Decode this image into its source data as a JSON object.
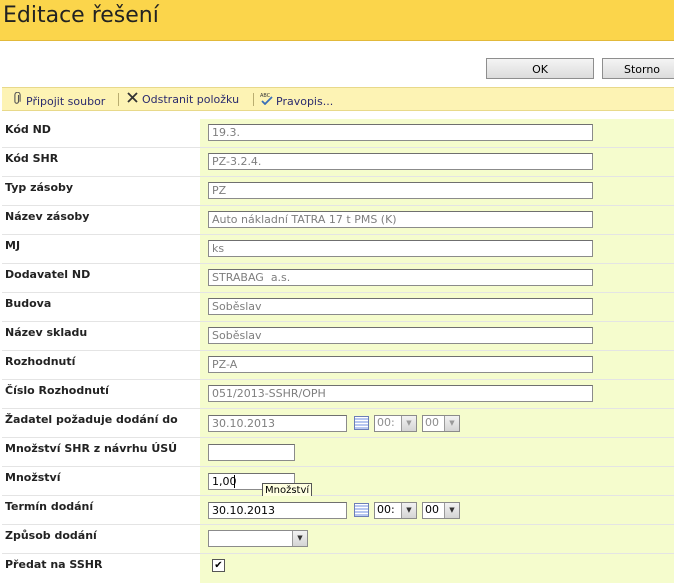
{
  "page": {
    "title": "Editace řešení"
  },
  "buttons": {
    "ok": "OK",
    "cancel": "Storno"
  },
  "toolbar": {
    "attach": "Připojit soubor",
    "remove": "Odstranit položku",
    "spell": "Pravopis..."
  },
  "fields": [
    {
      "label": "Kód ND",
      "value": "19.3."
    },
    {
      "label": "Kód SHR",
      "value": "PZ-3.2.4."
    },
    {
      "label": "Typ zásoby",
      "value": "PZ"
    },
    {
      "label": "Název zásoby",
      "value": "Auto nákladní TATRA 17 t PMS (K)"
    },
    {
      "label": "MJ",
      "value": "ks"
    },
    {
      "label": "Dodavatel ND",
      "value": "STRABAG  a.s."
    },
    {
      "label": "Budova",
      "value": "Soběslav"
    },
    {
      "label": "Název skladu",
      "value": "Soběslav"
    },
    {
      "label": "Rozhodnutí",
      "value": "PZ-A"
    },
    {
      "label": "Číslo Rozhodnutí",
      "value": "051/2013-SSHR/OPH"
    }
  ],
  "requested_delivery": {
    "label": "Žadatel požaduje dodání do",
    "date": "30.10.2013",
    "hour": "00:",
    "minute": "00"
  },
  "proposal_quantity": {
    "label": "Množství SHR z návrhu ÚSÚ",
    "value": ""
  },
  "quantity": {
    "label": "Množství",
    "value": "1,00",
    "tooltip": "Množství"
  },
  "delivery_term": {
    "label": "Termín dodání",
    "date": "30.10.2013",
    "hour": "00:",
    "minute": "00"
  },
  "delivery_method": {
    "label": "Způsob dodání",
    "value": ""
  },
  "hand_over": {
    "label": "Předat na SSHR",
    "checked": "✔"
  },
  "icons": {
    "attach": "paperclip-icon",
    "remove": "x-icon",
    "spell": "spellcheck-icon",
    "calendar": "calendar-icon",
    "dropdown": "chevron-down-icon"
  },
  "colors": {
    "title_bar": "#fbd54b",
    "toolbar": "#fdf3b4",
    "value_cell": "#f5fccd"
  }
}
